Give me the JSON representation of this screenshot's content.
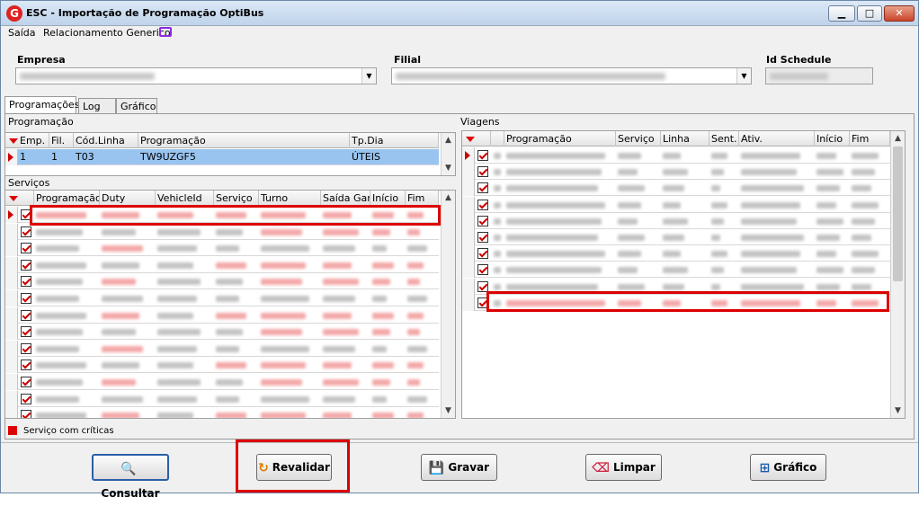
{
  "window": {
    "title": "ESC - Importação de Programação OptiBus",
    "app_icon": "G",
    "minimize": "▁",
    "maximize": "□",
    "close": "✕"
  },
  "menu": {
    "items": [
      "Saída",
      "Relacionamento Generico"
    ],
    "monitor_icon": "monitor-icon"
  },
  "filters": {
    "empresa_label": "Empresa",
    "filial_label": "Filial",
    "schedule_label": "Id Schedule"
  },
  "tabs": [
    "Programações",
    "Log",
    "Gráfico"
  ],
  "programacao": {
    "section_label": "Programação",
    "columns": [
      "Emp.",
      "Fil.",
      "Cód.Linha",
      "Programação",
      "Tp.Dia"
    ],
    "rows": [
      [
        "1",
        "1",
        "T03",
        "TW9UZGF5",
        "ÚTEIS"
      ]
    ]
  },
  "servicos": {
    "section_label": "Serviços",
    "columns": [
      "Programação",
      "Duty",
      "VehicleId",
      "Serviço",
      "Turno",
      "Saída Gar.",
      "Início",
      "Fim"
    ]
  },
  "viagens": {
    "section_label": "Viagens",
    "columns": [
      "Programação",
      "Serviço",
      "Linha",
      "Sent.",
      "Ativ.",
      "Início",
      "Fim"
    ]
  },
  "legend": {
    "text": "Serviço com críticas",
    "color": "#d00000"
  },
  "buttons": {
    "consultar": "Consultar",
    "revalidar": "Revalidar",
    "gravar": "Gravar",
    "limpar": "Limpar",
    "grafico": "Gráfico"
  },
  "colors": {
    "accent": "#d00000",
    "selection": "#99c4f0",
    "highlight_box": "#d00000"
  }
}
